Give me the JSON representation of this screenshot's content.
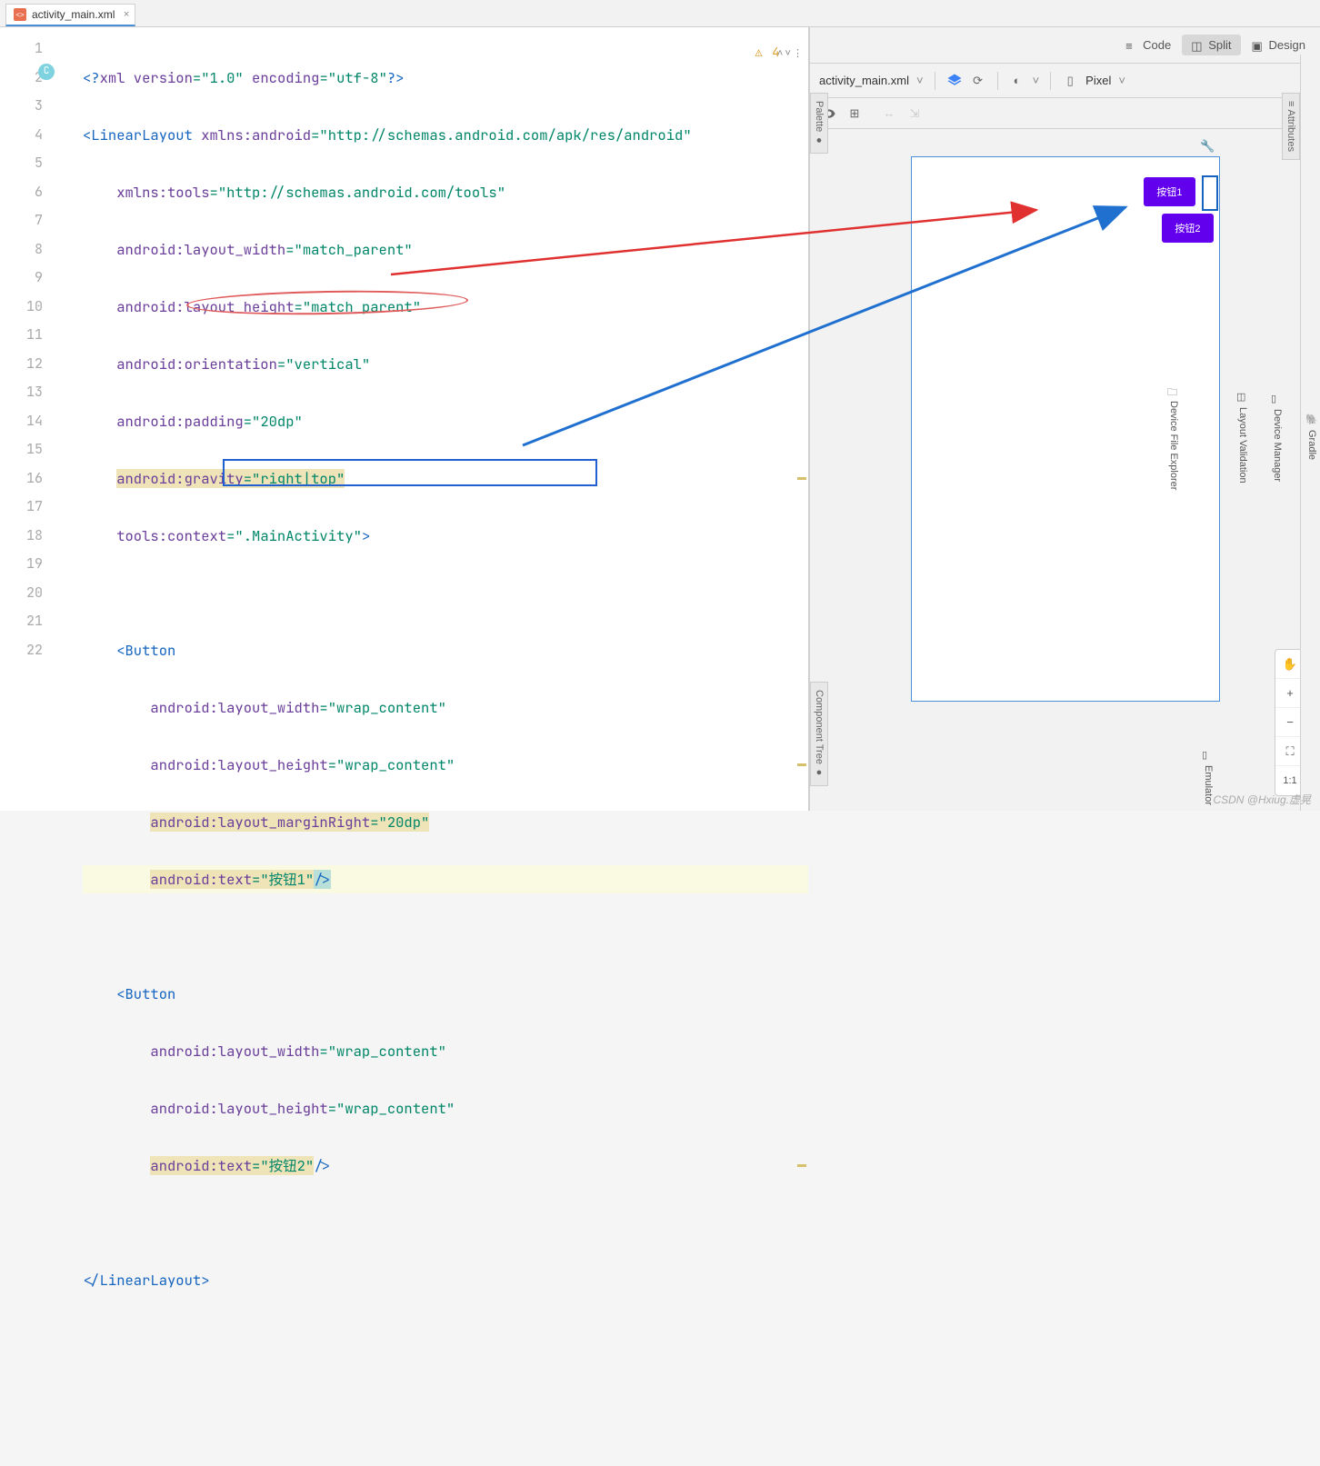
{
  "tab": {
    "filename": "activity_main.xml"
  },
  "viewModes": {
    "code": "Code",
    "split": "Split",
    "design": "Design"
  },
  "warnings": {
    "count": "4"
  },
  "lineNumbers": [
    "1",
    "2",
    "3",
    "4",
    "5",
    "6",
    "7",
    "8",
    "9",
    "10",
    "11",
    "12",
    "13",
    "14",
    "15",
    "16",
    "17",
    "18",
    "19",
    "20",
    "21",
    "22"
  ],
  "code": {
    "l1_a": "<?",
    "l1_b": "xml version",
    "l1_c": "=",
    "l1_d": "\"1.0\"",
    "l1_e": " encoding",
    "l1_f": "=",
    "l1_g": "\"utf-8\"",
    "l1_h": "?>",
    "l2_a": "<LinearLayout ",
    "l2_b": "xmlns:android",
    "l2_c": "=",
    "l2_d": "\"http://schemas.android.com/apk/res/android\"",
    "l3_a": "    ",
    "l3_b": "xmlns:tools",
    "l3_c": "=",
    "l3_d": "\"http://schemas.android.com/tools\"",
    "l4_a": "    ",
    "l4_b": "android:layout_width",
    "l4_c": "=",
    "l4_d": "\"match_parent\"",
    "l5_a": "    ",
    "l5_b": "android:layout_height",
    "l5_c": "=",
    "l5_d": "\"match_parent\"",
    "l6_a": "    ",
    "l6_b": "android:orientation",
    "l6_c": "=",
    "l6_d": "\"vertical\"",
    "l7_a": "    ",
    "l7_b": "android:padding",
    "l7_c": "=",
    "l7_d": "\"20dp\"",
    "l8_a": "    ",
    "l8_b": "android:gravity",
    "l8_c": "=",
    "l8_d": "\"right|top\"",
    "l9_a": "    ",
    "l9_b": "tools:context",
    "l9_c": "=",
    "l9_d": "\".MainActivity\"",
    "l9_e": ">",
    "l11_a": "    <Button",
    "l12_a": "        ",
    "l12_b": "android:layout_width",
    "l12_c": "=",
    "l12_d": "\"wrap_content\"",
    "l13_a": "        ",
    "l13_b": "android:layout_height",
    "l13_c": "=",
    "l13_d": "\"wrap_content\"",
    "l14_a": "        ",
    "l14_b": "android:layout_marginRight",
    "l14_c": "=",
    "l14_d": "\"20dp\"",
    "l15_a": "        ",
    "l15_b": "android:text",
    "l15_c": "=",
    "l15_d": "\"按钮1\"",
    "l15_e": "/>",
    "l17_a": "    <Button",
    "l18_a": "        ",
    "l18_b": "android:layout_width",
    "l18_c": "=",
    "l18_d": "\"wrap_content\"",
    "l19_a": "        ",
    "l19_b": "android:layout_height",
    "l19_c": "=",
    "l19_d": "\"wrap_content\"",
    "l20_a": "        ",
    "l20_b": "android:text",
    "l20_c": "=",
    "l20_d": "\"按钮2\"",
    "l20_e": "/>",
    "l22_a": "</LinearLayout>"
  },
  "preview": {
    "filename": "activity_main.xml",
    "device": "Pixel",
    "button1": "按钮1",
    "button2": "按钮2"
  },
  "sidePanels": {
    "palette": "Palette",
    "componentTree": "Component Tree",
    "attributes": "Attributes"
  },
  "farSide": {
    "gradle": "Gradle",
    "deviceManager": "Device Manager",
    "layoutValidation": "Layout Validation",
    "emulator": "Emulator",
    "deviceFileExplorer": "Device File Explorer"
  },
  "zoom": {
    "oneToOne": "1:1",
    "fit": "⛶"
  },
  "watermark": "CSDN @Hxiug.虚晃"
}
